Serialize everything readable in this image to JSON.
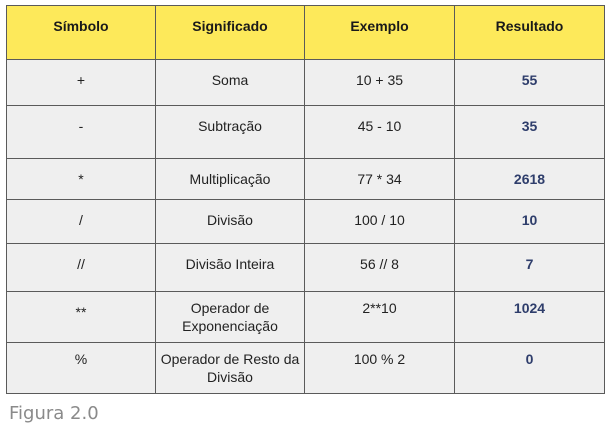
{
  "table": {
    "headers": [
      "Símbolo",
      "Significado",
      "Exemplo",
      "Resultado"
    ],
    "rows": [
      {
        "symbol": "+",
        "meaning": "Soma",
        "example": "10 + 35",
        "result": "55"
      },
      {
        "symbol": "-",
        "meaning": "Subtração",
        "example": "45 - 10",
        "result": "35"
      },
      {
        "symbol": "*",
        "meaning": "Multiplicação",
        "example": "77 * 34",
        "result": "2618"
      },
      {
        "symbol": "/",
        "meaning": "Divisão",
        "example": "100 / 10",
        "result": "10"
      },
      {
        "symbol": "//",
        "meaning": "Divisão Inteira",
        "example": "56 // 8",
        "result": "7"
      },
      {
        "symbol": "**",
        "meaning": "Operador de Exponenciação",
        "example": "2**10",
        "result": "1024"
      },
      {
        "symbol": "%",
        "meaning": "Operador de Resto da Divisão",
        "example": "100 % 2",
        "result": "0"
      }
    ]
  },
  "caption": "Figura 2.0",
  "colors": {
    "header_bg": "#fde95a",
    "row_bg": "#efefef",
    "result_text": "#2e3d6b",
    "caption_text": "#8a8a8a"
  }
}
